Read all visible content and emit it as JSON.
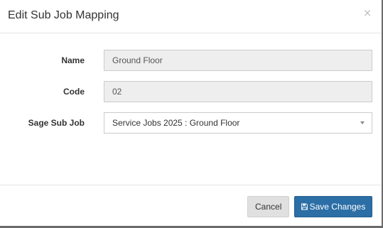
{
  "modal": {
    "title": "Edit Sub Job Mapping",
    "close_glyph": "×"
  },
  "form": {
    "name": {
      "label": "Name",
      "value": "Ground Floor"
    },
    "code": {
      "label": "Code",
      "value": "02"
    },
    "sage_sub_job": {
      "label": "Sage Sub Job",
      "selected": "Service Jobs 2025 : Ground Floor"
    }
  },
  "footer": {
    "cancel_label": "Cancel",
    "save_label": "Save Changes"
  },
  "colors": {
    "primary": "#2c6ea6",
    "readonly_bg": "#eeeeee",
    "cancel_bg": "#e0e0e0"
  },
  "icons": {
    "close": "close-icon",
    "caret": "caret-down-icon",
    "save": "floppy-disk-icon"
  }
}
